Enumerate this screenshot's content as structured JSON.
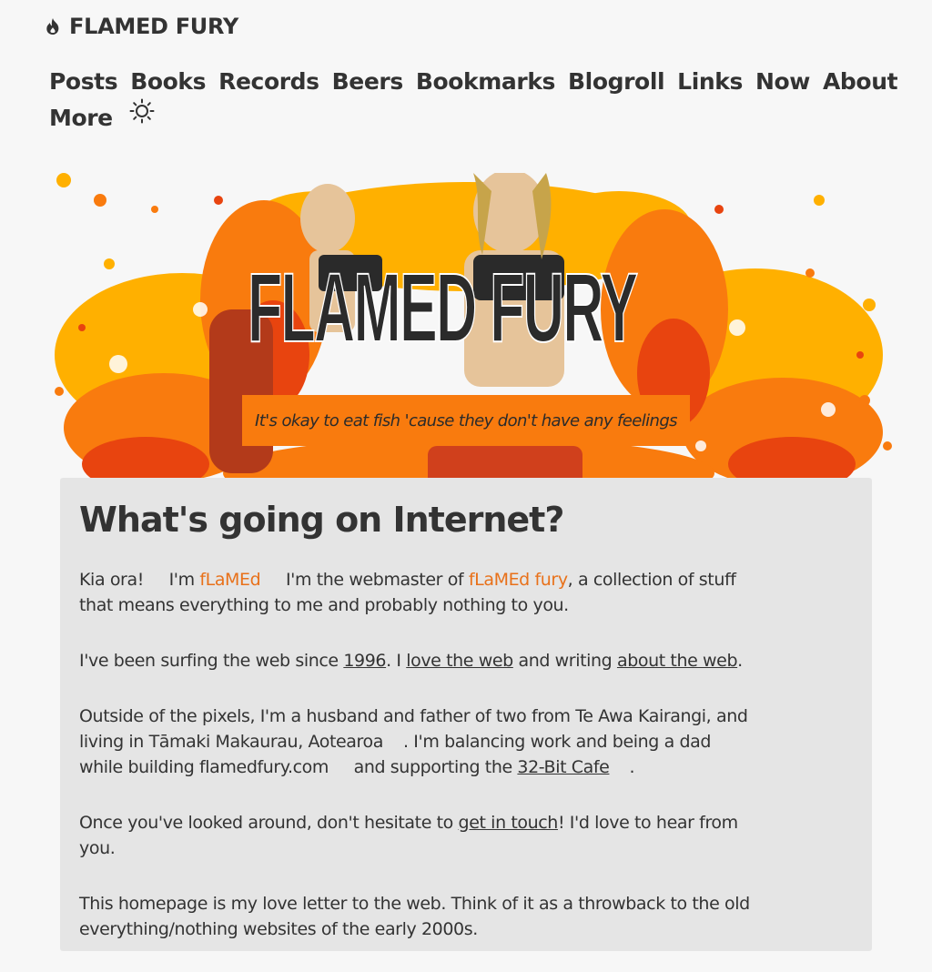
{
  "brand": {
    "title": "FLAMED FURY",
    "icon": "flame-icon"
  },
  "nav": {
    "items": [
      "Posts",
      "Books",
      "Records",
      "Beers",
      "Bookmarks",
      "Blogroll",
      "Links",
      "Now",
      "About",
      "More"
    ],
    "theme_icon": "sun-icon"
  },
  "banner": {
    "logo": "FLAMED FURY",
    "tagline": "It's okay to eat fish 'cause they don't have any feelings"
  },
  "colors": {
    "accent": "#f97b0e",
    "link": "#e8711a",
    "card": "#e5e5e5",
    "text": "#333333"
  },
  "main": {
    "heading": "What's going on Internet?",
    "p1": {
      "a": "Kia ora!",
      "b": "I'm ",
      "link1": "fLaMEd",
      "c": "I'm the webmaster of ",
      "link2": "fLaMEd fury",
      "d": ", a collection of stuff that means everything to me and probably nothing to you."
    },
    "p2": {
      "a": "I've been surfing the web since ",
      "link1": "1996",
      "b": ". I ",
      "link2": "love the web",
      "c": " and writing ",
      "link3": "about the web",
      "d": "."
    },
    "p3": {
      "a": "Outside of the pixels, I'm a husband and father of two from Te Awa Kairangi, and living in Tāmaki Makaurau, Aotearoa",
      "b": ". I'm balancing work and being a dad",
      "c": "while building flamedfury.com",
      "d": "and supporting the ",
      "link1": "32-Bit Cafe",
      "e": "."
    },
    "p4": {
      "a": "Once you've looked around, don't hesitate to ",
      "link1": "get in touch",
      "b": "! I'd love to hear from you."
    },
    "p5": "This homepage is my love letter to the web. Think of it as a throwback to the old everything/nothing websites of the early 2000s."
  }
}
